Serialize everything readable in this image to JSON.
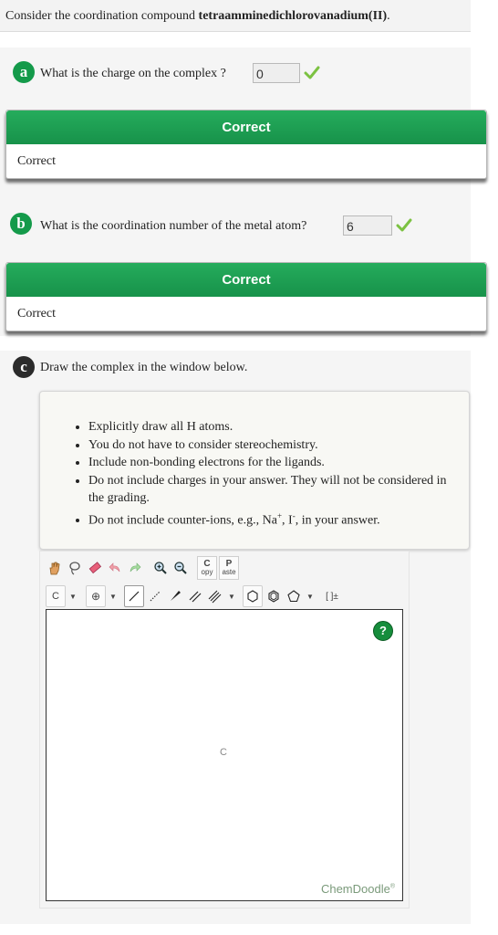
{
  "intro": {
    "prefix": "Consider the coordination compound ",
    "compound": "tetraamminedichlorovanadium(II)",
    "suffix": "."
  },
  "part_a": {
    "badge": "a",
    "question": "What is the charge on the complex ?",
    "answer": "0",
    "feedback_title": "Correct",
    "feedback_body": "Correct"
  },
  "part_b": {
    "badge": "b",
    "question": "What is the coordination number of the metal atom?",
    "answer": "6",
    "feedback_title": "Correct",
    "feedback_body": "Correct"
  },
  "part_c": {
    "badge": "c",
    "question": "Draw the complex in the window below.",
    "instructions": [
      "Explicitly draw all H atoms.",
      "You do not have to consider stereochemistry.",
      "Include non-bonding electrons for the ligands.",
      "Do not include charges in your answer. They will not be considered in the grading."
    ],
    "counterion_text": {
      "before": "Do not include counter-ions, e.g., Na",
      "sup1": "+",
      "mid": ", I",
      "sup2": "-",
      "after": ", in your answer."
    }
  },
  "chemdoodle": {
    "copy_label": "C",
    "copy_sub": "opy",
    "paste_label": "P",
    "paste_sub": "aste",
    "element_label": "C",
    "charge_label": "⊕",
    "bracket_label": "[ ]±",
    "help_label": "?",
    "canvas_marker": "C",
    "brand": "ChemDoodle",
    "brand_mark": "®"
  },
  "colors": {
    "correct_green": "#149a4a",
    "check_green": "#7cc242",
    "help_green": "#168d3c"
  },
  "icons": [
    "hand-icon",
    "lasso-icon",
    "eraser-icon",
    "undo-icon",
    "redo-icon",
    "zoom-in-icon",
    "zoom-out-icon",
    "single-bond-icon",
    "dotted-bond-icon",
    "wedge-bond-icon",
    "double-bond-icon",
    "triple-bond-icon",
    "hexagon-icon",
    "benzene-icon",
    "pentagon-icon",
    "check-icon",
    "help-icon"
  ]
}
